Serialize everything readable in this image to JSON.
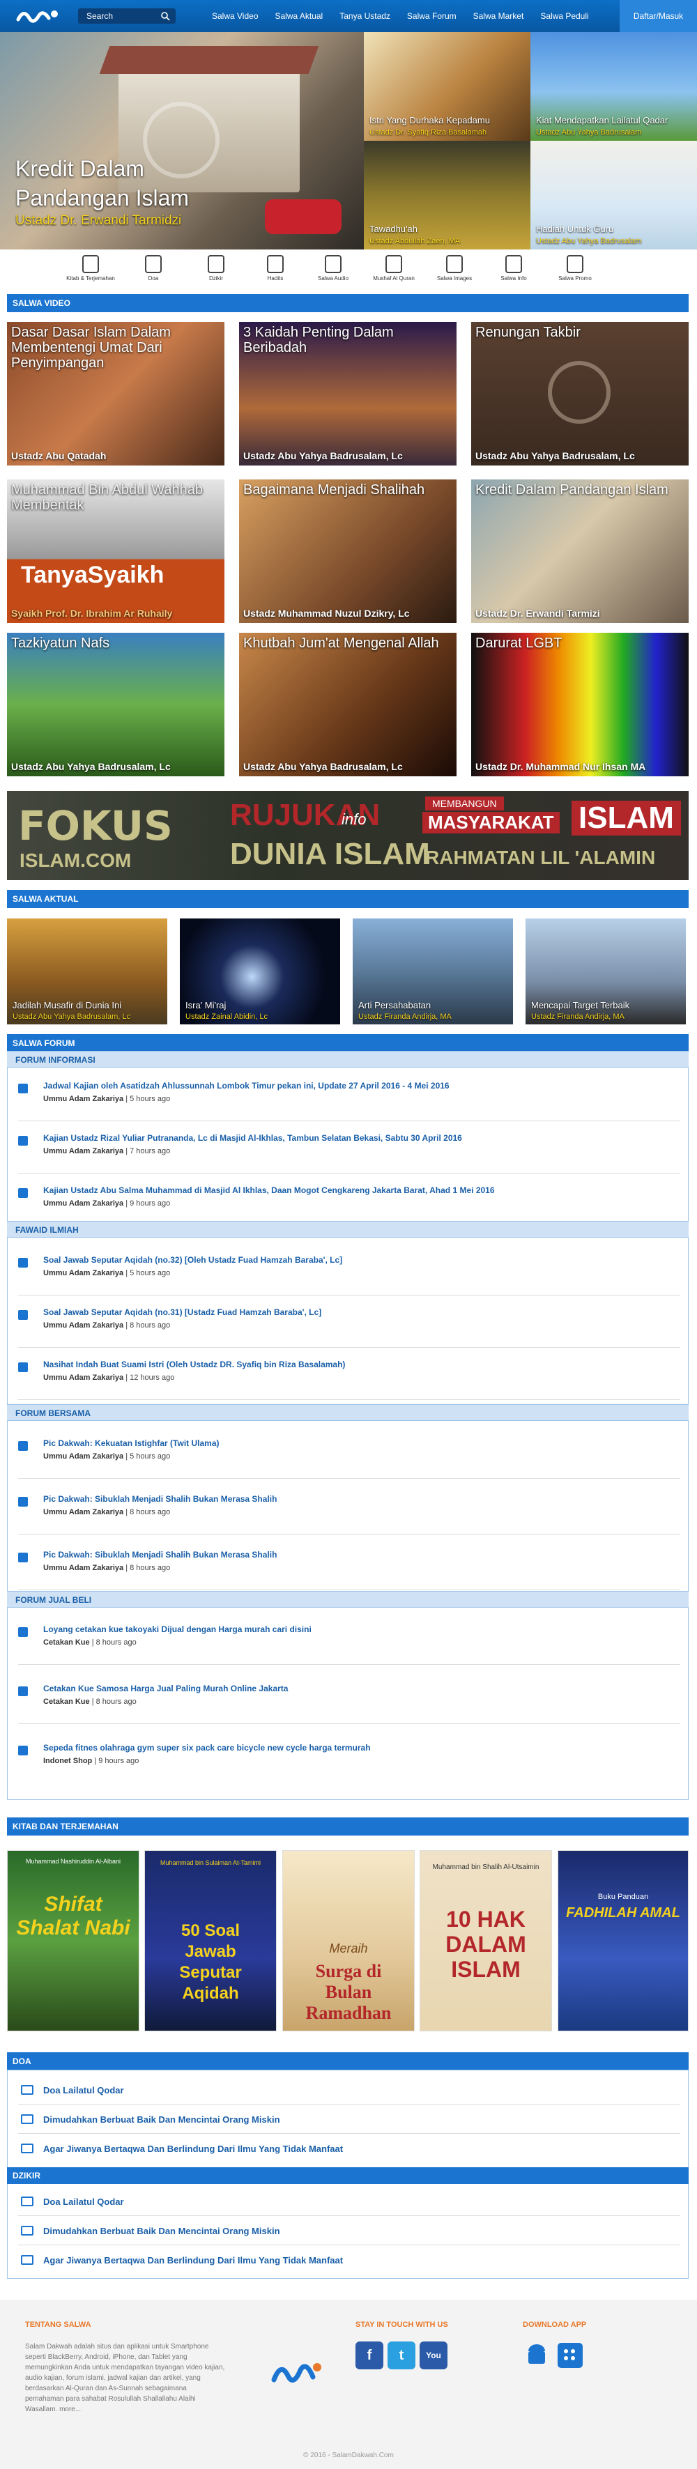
{
  "header": {
    "search_placeholder": "Search",
    "nav": [
      "Salwa Video",
      "Salwa Aktual",
      "Tanya Ustadz",
      "Salwa Forum",
      "Salwa Market",
      "Salwa Peduli"
    ],
    "login": "Daftar/Masuk"
  },
  "hero": {
    "title": "Kredit Dalam Pandangan Islam",
    "author": "Ustadz Dr. Erwandi Tarmidzi",
    "tiles": [
      {
        "title": "Istri Yang Durhaka Kepadamu",
        "author": "Ustadz Dr. Syafiq Riza Basalamah"
      },
      {
        "title": "Kiat Mendapatkan Lailatul Qadar",
        "author": "Ustadz Abu Yahya Badrusalam"
      },
      {
        "title": "Tawadhu'ah",
        "author": "Ustadz Abdullah Zaen, MA"
      },
      {
        "title": "Hadiah Untuk Guru",
        "author": "Ustadz Abu Yahya Badrusalam"
      }
    ]
  },
  "icons": [
    "Kitab & Terjemahan",
    "Doa",
    "Dzikir",
    "Hadits",
    "Salwa Audio",
    "Mushaf Al Quran",
    "Salwa Images",
    "Salwa Info",
    "Salwa Promo"
  ],
  "video": {
    "heading": "SALWA VIDEO",
    "items": [
      {
        "title": "Dasar Dasar Islam Dalam Membentengi Umat Dari Penyimpangan",
        "author": "Ustadz Abu Qatadah"
      },
      {
        "title": "3 Kaidah Penting Dalam Beribadah",
        "author": "Ustadz Abu Yahya Badrusalam, Lc"
      },
      {
        "title": "Renungan Takbir",
        "author": "Ustadz Abu Yahya Badrusalam, Lc"
      },
      {
        "title": "Muhammad Bin Abdul Wahhab Membentak",
        "author": "Syaikh Prof. Dr. Ibrahim Ar Ruhaily"
      },
      {
        "title": "Bagaimana Menjadi Shalihah",
        "author": "Ustadz Muhammad Nuzul Dzikry, Lc"
      },
      {
        "title": "Kredit Dalam Pandangan Islam",
        "author": "Ustadz Dr. Erwandi Tarmizi"
      },
      {
        "title": "Tazkiyatun Nafs",
        "author": "Ustadz Abu Yahya Badrusalam, Lc"
      },
      {
        "title": "Khutbah Jum'at Mengenal Allah",
        "author": "Ustadz Abu Yahya Badrusalam, Lc"
      },
      {
        "title": "Darurat LGBT",
        "author": "Ustadz Dr. Muhammad Nur Ihsan MA"
      }
    ],
    "overlay_text": "TanyaSyaikh"
  },
  "banner": {
    "fokus": "FOKUS",
    "fokus_url": "ISLAM.COM",
    "rujukan": "RUJUKAN",
    "info": "info",
    "dunia": "DUNIA ISLAM",
    "membangun": "MEMBANGUN",
    "masyarakat": "MASYARAKAT",
    "islam": "ISLAM",
    "rahmatan": "RAHMATAN LIL 'ALAMIN"
  },
  "aktual": {
    "heading": "SALWA AKTUAL",
    "items": [
      {
        "title": "Jadilah Musafir di Dunia Ini",
        "author": "Ustadz Abu Yahya Badrusalam, Lc"
      },
      {
        "title": "Isra' Mi'raj",
        "author": "Ustadz Zainal Abidin, Lc"
      },
      {
        "title": "Arti Persahabatan",
        "author": "Ustadz Firanda Andirja, MA"
      },
      {
        "title": "Mencapai Target Terbaik",
        "author": "Ustadz Firanda Andirja, MA"
      }
    ]
  },
  "forum": {
    "heading": "SALWA FORUM",
    "sections": [
      {
        "title": "FORUM INFORMASI",
        "posts": [
          {
            "title": "Jadwal Kajian oleh Asatidzah Ahlussunnah Lombok Timur pekan ini, Update 27 April 2016 - 4 Mei 2016",
            "user": "Ummu Adam Zakariya",
            "time": "5 hours ago"
          },
          {
            "title": "Kajian Ustadz Rizal Yuliar Putrananda, Lc di Masjid Al-Ikhlas, Tambun Selatan Bekasi, Sabtu 30 April 2016",
            "user": "Ummu Adam Zakariya",
            "time": "7 hours ago"
          },
          {
            "title": "Kajian Ustadz Abu Salma Muhammad di Masjid Al Ikhlas, Daan Mogot Cengkareng Jakarta Barat, Ahad 1 Mei 2016",
            "user": "Ummu Adam Zakariya",
            "time": "9 hours ago"
          }
        ]
      },
      {
        "title": "FAWAID ILMIAH",
        "posts": [
          {
            "title": "Soal Jawab Seputar Aqidah (no.32) [Oleh Ustadz Fuad Hamzah Baraba', Lc]",
            "user": "Ummu Adam Zakariya",
            "time": "5 hours ago"
          },
          {
            "title": "Soal Jawab Seputar Aqidah (no.31) [Ustadz Fuad Hamzah Baraba', Lc]",
            "user": "Ummu Adam Zakariya",
            "time": "8 hours ago"
          },
          {
            "title": "Nasihat Indah Buat Suami Istri (Oleh Ustadz DR. Syafiq bin Riza Basalamah)",
            "user": "Ummu Adam Zakariya",
            "time": "12 hours ago"
          }
        ]
      },
      {
        "title": "FORUM BERSAMA",
        "posts": [
          {
            "title": "Pic Dakwah: Kekuatan Istighfar (Twit Ulama)",
            "user": "Ummu Adam Zakariya",
            "time": "5 hours ago"
          },
          {
            "title": "Pic Dakwah: Sibuklah Menjadi Shalih Bukan Merasa Shalih",
            "user": "Ummu Adam Zakariya",
            "time": "8 hours ago"
          },
          {
            "title": "Pic Dakwah: Sibuklah Menjadi Shalih Bukan Merasa Shalih",
            "user": "Ummu Adam Zakariya",
            "time": "8 hours ago"
          }
        ]
      },
      {
        "title": "FORUM JUAL BELI",
        "posts": [
          {
            "title": "Loyang cetakan kue takoyaki Dijual dengan Harga murah cari disini",
            "user": "Cetakan Kue",
            "time": "8 hours ago"
          },
          {
            "title": "Cetakan Kue Samosa Harga Jual Paling Murah Online Jakarta",
            "user": "Cetakan Kue",
            "time": "8 hours ago"
          },
          {
            "title": "Sepeda fitnes olahraga gym super six pack care bicycle new cycle harga termurah",
            "user": "Indonet Shop",
            "time": "9 hours ago"
          }
        ]
      }
    ]
  },
  "kitab": {
    "heading": "KITAB DAN TERJEMAHAN",
    "books": [
      {
        "top": "Muhammad Nashiruddin Al-Albani",
        "title": "Shifat Shalat Nabi"
      },
      {
        "top": "Muhammad bin Sulaiman At-Tamimi",
        "title": "50 Soal Jawab Seputar Aqidah"
      },
      {
        "top": "Meraih",
        "title": "Surga di Bulan Ramadhan"
      },
      {
        "top": "Muhammad bin Shalih Al-Utsaimin",
        "title": "10 HAK DALAM ISLAM"
      },
      {
        "top": "Buku Panduan",
        "title": "FADHILAH AMAL"
      }
    ]
  },
  "doa": {
    "heading": "DOA",
    "items": [
      "Doa Lailatul Qodar",
      "Dimudahkan Berbuat Baik Dan Mencintai Orang Miskin",
      "Agar Jiwanya Bertaqwa Dan Berlindung Dari Ilmu Yang Tidak Manfaat"
    ]
  },
  "dzikir": {
    "heading": "DZIKIR",
    "items": [
      "Doa Lailatul Qodar",
      "Dimudahkan Berbuat Baik Dan Mencintai Orang Miskin",
      "Agar Jiwanya Bertaqwa Dan Berlindung Dari Ilmu Yang Tidak Manfaat"
    ]
  },
  "footer": {
    "about_heading": "TENTANG SALWA",
    "about_text": "Salam Dakwah adalah situs dan aplikasi untuk Smartphone seperti BlackBerry, Android, iPhone, dan Tablet yang memungkinkan Anda untuk mendapatkan tayangan video kajian, audio kajian, forum islami, jadwal kajian dan artikel, yang berdasarkan Al-Quran dan As-Sunnah sebagaimana pemahaman para sahabat Rosulullah Shallallahu Alaihi Wasallam. more...",
    "touch_heading": "STAY IN TOUCH WITH US",
    "download_heading": "DOWNLOAD APP",
    "copyright": "© 2016 - SalamDakwah.Com"
  }
}
